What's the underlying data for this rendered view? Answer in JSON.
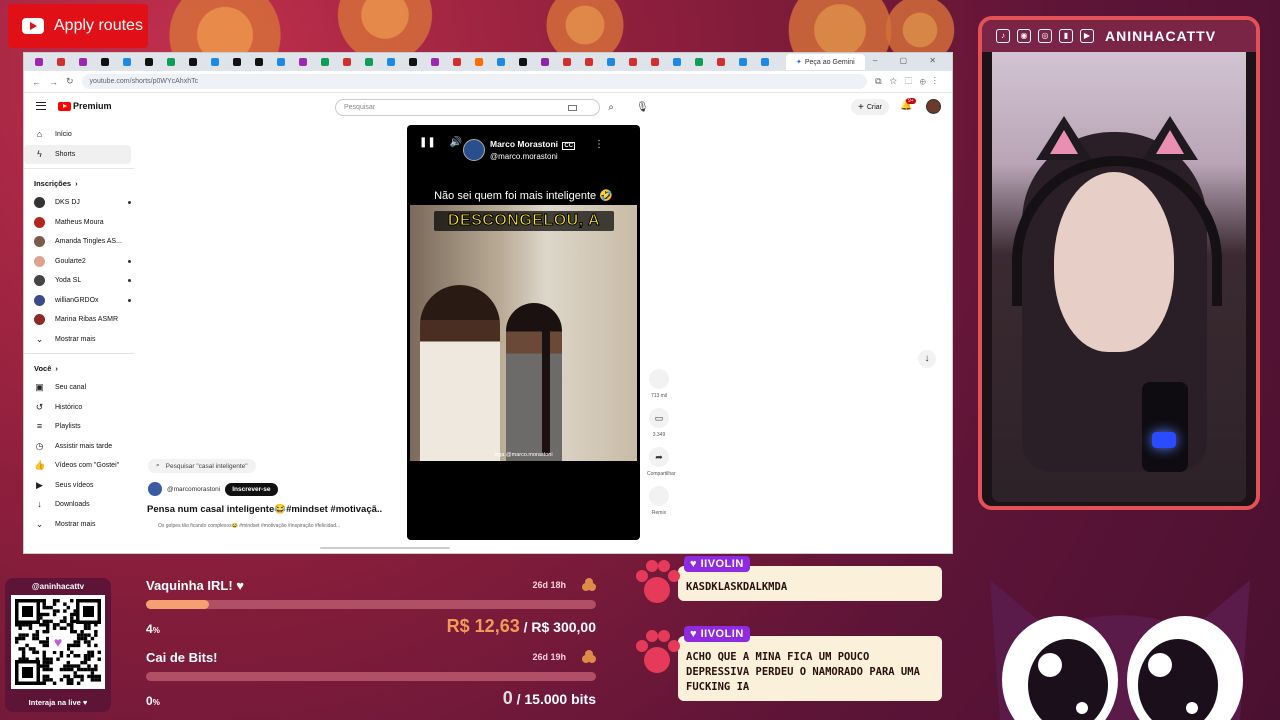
{
  "overlay": {
    "apply_button": "Apply routes"
  },
  "browser": {
    "gemini_tab": "Peça ao Gemini",
    "url": "youtube.com/shorts/p0WYcAhxhTc",
    "tab_colors": [
      "#9c27b0",
      "#d32f2f",
      "#9c27b0",
      "#111111",
      "#1e88e5",
      "#111111",
      "#0f9d58",
      "#111111",
      "#1e88e5",
      "#111111",
      "#111111",
      "#1e88e5",
      "#9c27b0",
      "#0f9d58",
      "#d32f2f",
      "#0f9d58",
      "#1e88e5",
      "#111111",
      "#9c27b0",
      "#d32f2f",
      "#ff6d00",
      "#1e88e5",
      "#111111",
      "#8e24aa",
      "#d32f2f",
      "#d32f2f",
      "#1e88e5",
      "#d32f2f",
      "#d32f2f",
      "#1e88e5",
      "#0f9d58",
      "#d32f2f",
      "#1e88e5",
      "#1e88e5"
    ]
  },
  "youtube": {
    "logo": "Premium",
    "search_placeholder": "Pesquisar",
    "create_label": "Criar",
    "notifications": "9+",
    "sidebar": {
      "home": "Início",
      "shorts": "Shorts",
      "subs_header": "Inscrições",
      "subs": [
        {
          "name": "DKS DJ",
          "color": "#333333",
          "dot": true
        },
        {
          "name": "Matheus Moura",
          "color": "#b3261e",
          "dot": false
        },
        {
          "name": "Amanda Tingles AS...",
          "color": "#7a5a4a",
          "dot": false
        },
        {
          "name": "Goularte2",
          "color": "#e0a090",
          "dot": true
        },
        {
          "name": "Yoda SL",
          "color": "#444444",
          "dot": true
        },
        {
          "name": "willianGRDOx",
          "color": "#3a4a8a",
          "dot": true
        },
        {
          "name": "Marina Ribas ASMR",
          "color": "#8a2a2a",
          "dot": false
        }
      ],
      "show_more": "Mostrar mais",
      "you_header": "Você",
      "you_items": [
        "Seu canal",
        "Histórico",
        "Playlists",
        "Assistir mais tarde",
        "Vídeos com \"Gostei\"",
        "Seus vídeos",
        "Downloads",
        "Mostrar mais"
      ]
    },
    "short": {
      "search_pill": "Pesquisar \"casal inteligente\"",
      "channel": "@marcomorastoni",
      "subscribe": "Inscrever-se",
      "title": "Pensa num casal inteligente😂#mindset #motivaçã...",
      "description": "Os golpes tão ficando complexos😂 #mindset #motivação #inspiração #felicidad...",
      "video_channel_name": "Marco Morastoni",
      "video_channel_handle": "@marco.morastoni",
      "video_cc": "CC",
      "video_caption": "Não sei quem foi mais inteligente 🤣",
      "video_overlay": "DESCONGELOU, A",
      "video_watermark": "siga @marco.morastoni",
      "likes": "713 mil",
      "comments": "3.349",
      "share": "Compartilhar",
      "remix": "Remix"
    }
  },
  "stream": {
    "streamer": "ANINHACATTV",
    "qr_handle": "@aninhacattv",
    "qr_footer": "Interaja na live ♥",
    "goals": [
      {
        "title": "Vaquinha IRL! ♥",
        "time": "26d 18h",
        "percent": 4,
        "percent_label": "4",
        "current": "R$ 12,63",
        "separator": "/",
        "target": "R$ 300,00"
      },
      {
        "title": "Cai de Bits!",
        "time": "26d 19h",
        "percent": 0,
        "percent_label": "0",
        "current": "0",
        "separator": "/",
        "target": "15.000 bits"
      }
    ],
    "chat": [
      {
        "user": "♥ IIVOLIN",
        "message": "KASDKLASKDALKMDA"
      },
      {
        "user": "♥ IIVOLIN",
        "message": "ACHO QUE A MINA FICA UM POUCO DEPRESSIVA PERDEU O NAMORADO PARA UMA FUCKING IA"
      }
    ]
  }
}
